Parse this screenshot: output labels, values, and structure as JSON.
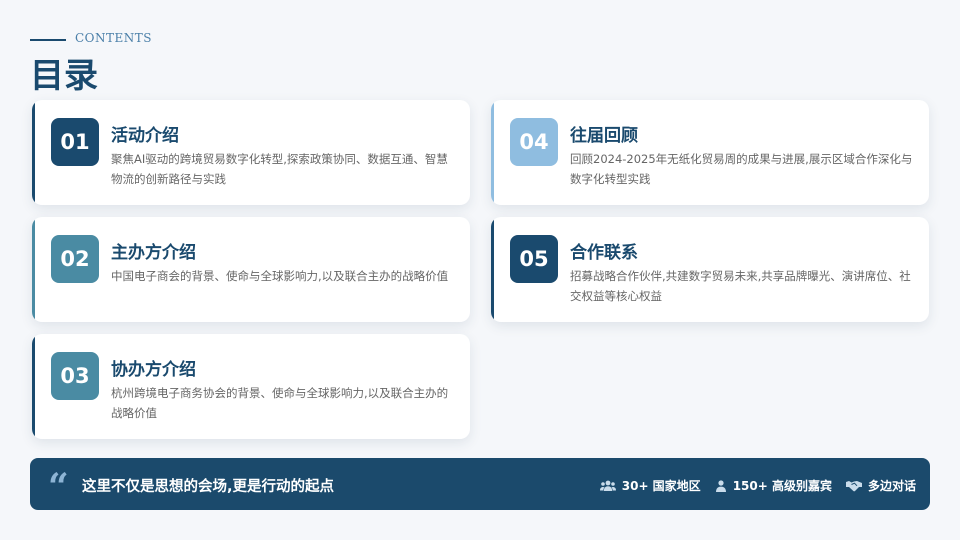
{
  "header": {
    "contents_label": "CONTENTS",
    "title": "目录"
  },
  "cards": [
    {
      "num": "01",
      "title": "活动介绍",
      "desc": "聚焦AI驱动的跨境贸易数字化转型,探索政策协同、数据互通、智慧物流的创新路径与实践",
      "num_color": "#1a4a6e",
      "accent_color": "#1a4a6e"
    },
    {
      "num": "02",
      "title": "主办方介绍",
      "desc": "中国电子商会的背景、使命与全球影响力,以及联合主办的战略价值",
      "num_color": "#4a8ba3",
      "accent_color": "#4a8ba3"
    },
    {
      "num": "03",
      "title": "协办方介绍",
      "desc": "杭州跨境电子商务协会的背景、使命与全球影响力,以及联合主办的战略价值",
      "num_color": "#4a8ba3",
      "accent_color": "#1a4a6e"
    },
    {
      "num": "04",
      "title": "往届回顾",
      "desc": "回顾2024-2025年无纸化贸易周的成果与进展,展示区域合作深化与数字化转型实践",
      "num_color": "#8fbde0",
      "accent_color": "#8fbde0"
    },
    {
      "num": "05",
      "title": "合作联系",
      "desc": "招募战略合作伙伴,共建数字贸易未来,共享品牌曝光、演讲席位、社交权益等核心权益",
      "num_color": "#1a4a6e",
      "accent_color": "#1a4a6e"
    }
  ],
  "banner": {
    "quote": "这里不仅是思想的会场,更是行动的起点",
    "stats": [
      {
        "icon": "users-icon",
        "text": "30+ 国家地区"
      },
      {
        "icon": "person-icon",
        "text": "150+ 高级别嘉宾"
      },
      {
        "icon": "handshake-icon",
        "text": "多边对话"
      }
    ]
  }
}
